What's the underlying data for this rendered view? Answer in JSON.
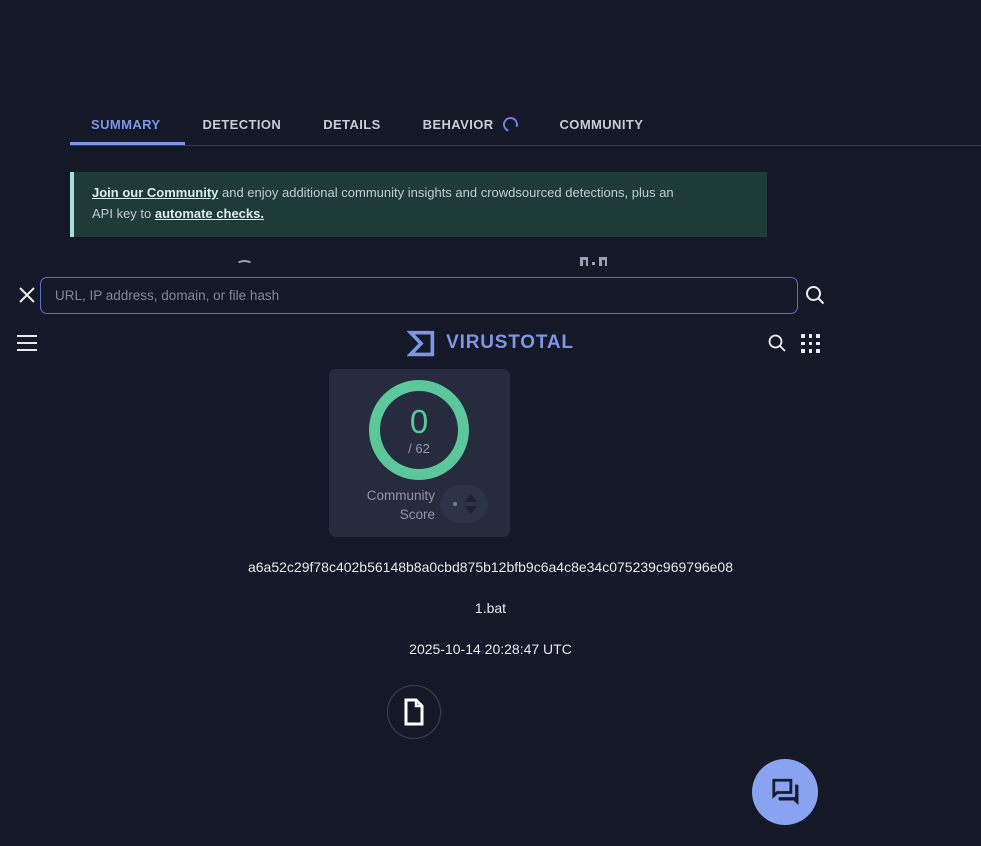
{
  "tabs": [
    {
      "label": "SUMMARY",
      "active": true
    },
    {
      "label": "DETECTION",
      "active": false
    },
    {
      "label": "DETAILS",
      "active": false
    },
    {
      "label": "BEHAVIOR",
      "active": false,
      "loading": true
    },
    {
      "label": "COMMUNITY",
      "active": false
    }
  ],
  "banner": {
    "link_community": "Join our Community",
    "line1_rest": " and enjoy additional community insights and crowdsourced detections, plus an",
    "line2_pre": "API key to ",
    "link_automate": "automate checks."
  },
  "search": {
    "placeholder": "URL, IP address, domain, or file hash"
  },
  "header": {
    "brand": "VIRUSTOTAL"
  },
  "score": {
    "value": "0",
    "total": "/ 62",
    "label_line1": "Community",
    "label_line2": "Score"
  },
  "file": {
    "hash": "a6a52c29f78c402b56148b8a0cbd875b12bfb9c6a4c8e34c075239c969796e08",
    "name": "1.bat",
    "date": "2025-10-14 20:28:47 UTC"
  },
  "icons": {
    "close": "close-icon",
    "search": "search-icon",
    "menu": "hamburger-menu-icon",
    "apps": "apps-grid-icon",
    "file": "file-document-icon",
    "chat": "chat-forum-icon",
    "vote": "community-vote-widget",
    "spinner": "loading-spinner-icon"
  },
  "colors": {
    "accent": "#7e96e8",
    "green": "#5cc79b",
    "banner_bg": "#1e3b39",
    "banner_border": "#a5ded9",
    "fab": "#8aa3f1",
    "background": "#151826",
    "card": "#262c3e"
  }
}
